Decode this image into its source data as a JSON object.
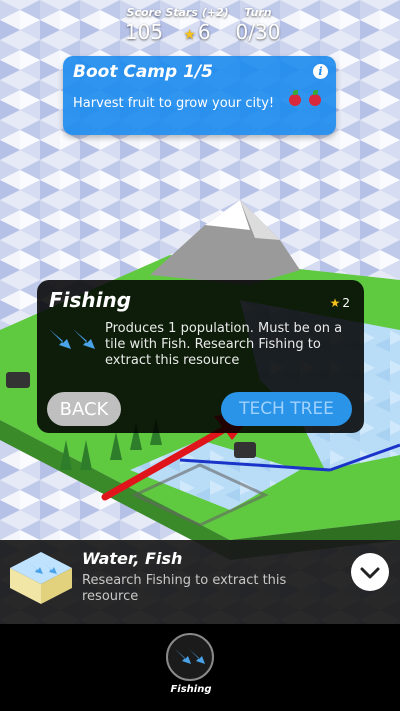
{
  "hud": {
    "score_label": "Score",
    "score_value": "105",
    "stars_label": "Stars (+2)",
    "stars_value": "6",
    "turn_label": "Turn",
    "turn_value": "0/30"
  },
  "bootcamp": {
    "title": "Boot Camp 1/5",
    "description": "Harvest fruit to grow your city!",
    "info_icon": "info-icon",
    "goal_icons": [
      "fruit-icon",
      "fruit-icon"
    ]
  },
  "popup": {
    "title": "Fishing",
    "cost": "2",
    "description": "Produces 1 population. Must be on a tile with Fish. Research Fishing to extract this resource",
    "back_label": "BACK",
    "tech_tree_label": "TECH TREE"
  },
  "tile_info": {
    "title": "Water, Fish",
    "description": "Research Fishing to extract this resource"
  },
  "footer": {
    "action_label": "Fishing"
  },
  "colors": {
    "accent_blue": "#1e8cee",
    "star_gold": "#f6c21b",
    "arrow_red": "#e0141b",
    "grass": "#5fc93f",
    "water": "#bfe3ff"
  }
}
